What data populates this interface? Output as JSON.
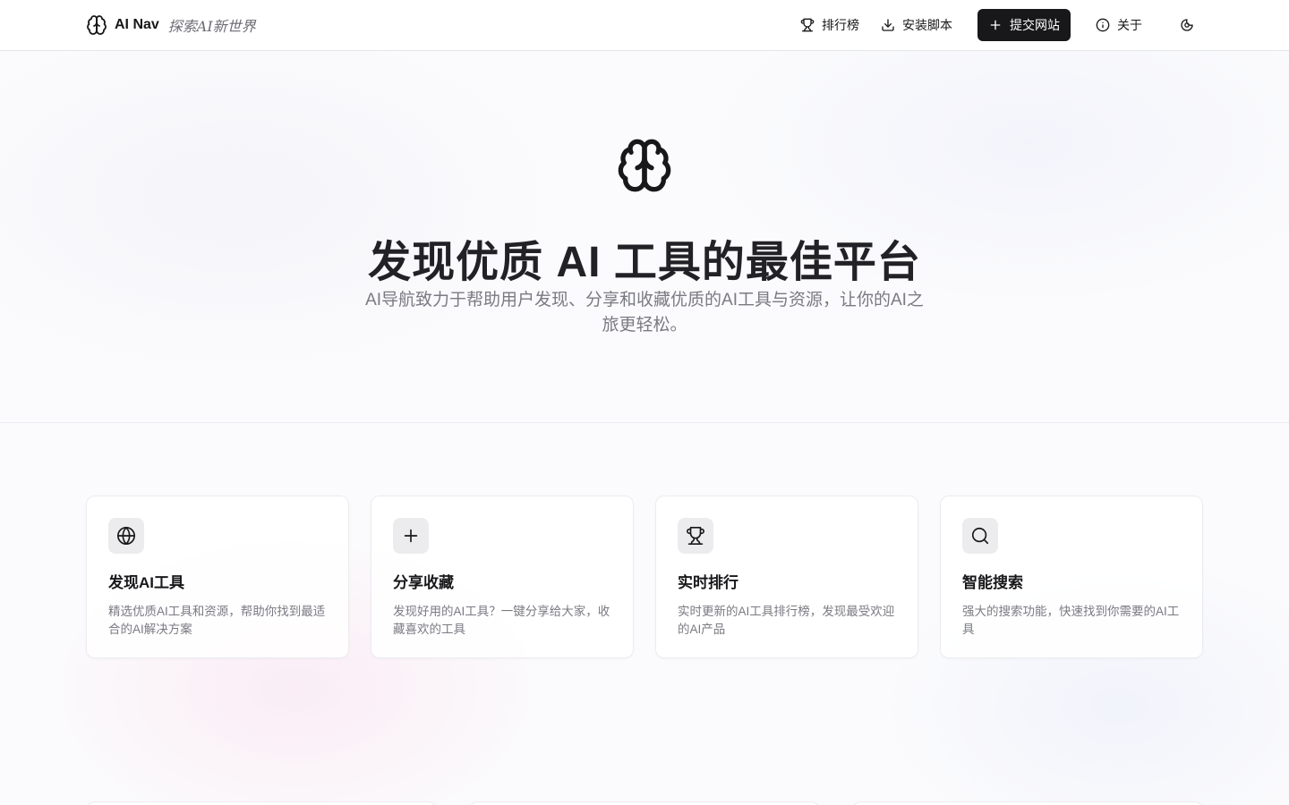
{
  "header": {
    "brand_name": "AI Nav",
    "brand_tagline": "探索AI新世界",
    "nav": {
      "ranking": "排行榜",
      "install": "安装脚本",
      "submit": "提交网站",
      "about": "关于"
    }
  },
  "hero": {
    "title": "发现优质 AI 工具的最佳平台",
    "subtitle": "AI导航致力于帮助用户发现、分享和收藏优质的AI工具与资源，让你的AI之旅更轻松。"
  },
  "features": [
    {
      "icon": "globe-icon",
      "title": "发现AI工具",
      "desc": "精选优质AI工具和资源，帮助你找到最适合的AI解决方案"
    },
    {
      "icon": "plus-icon",
      "title": "分享收藏",
      "desc": "发现好用的AI工具？一键分享给大家，收藏喜欢的工具"
    },
    {
      "icon": "trophy-icon",
      "title": "实时排行",
      "desc": "实时更新的AI工具排行榜，发现最受欢迎的AI产品"
    },
    {
      "icon": "search-icon",
      "title": "智能搜索",
      "desc": "强大的搜索功能，快速找到你需要的AI工具"
    }
  ]
}
